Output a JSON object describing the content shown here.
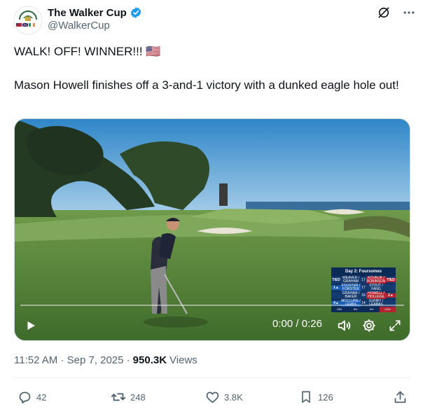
{
  "author": {
    "display_name": "The Walker Cup",
    "handle": "@WalkerCup",
    "verified": true,
    "avatar_icon": "walker-cup-logo"
  },
  "post": {
    "line1": "WALK! OFF! WINNER!!! 🇺🇸",
    "line2": "Mason Howell finishes off a 3-and-1 victory with a dunked eagle hole out!"
  },
  "video": {
    "time_current": "0:00",
    "time_separator": "/",
    "time_total": "0:26",
    "progress_fraction": 0,
    "scoreboard": {
      "header": "Day 2: Foursomes",
      "rows": [
        {
          "left": "TIED",
          "p1": "WEAVER / GRAHAM",
          "p2": "KOVALIK / ROBINSON",
          "right": "TIED",
          "vs": "17"
        },
        {
          "left": "1▲",
          "p1": "FOUSTER / FORSTER",
          "p2": "STOUT / FANG",
          "right": "",
          "vs": "17"
        },
        {
          "left": "",
          "p1": "GRAHAM / BAKER",
          "p2": "HOWELL / HOLLEGE",
          "right": "2▲",
          "vs": "16"
        },
        {
          "left": "4▲",
          "p1": "MCCLURE / LEWIS",
          "p2": "GUNBY / LEABAS",
          "right": "",
          "vs": "14"
        }
      ],
      "footer": [
        "GBI",
        "5½",
        "6½",
        "USA"
      ]
    }
  },
  "meta": {
    "timestamp": "11:52 AM · Sep 7, 2025 ·",
    "views_count": "950.3K",
    "views_label": "Views"
  },
  "actions": {
    "replies": "42",
    "reposts": "248",
    "likes": "3.8K",
    "bookmarks": "126"
  },
  "colors": {
    "accent": "#1d9bf0",
    "text_primary": "#0f1419",
    "text_secondary": "#536471"
  }
}
